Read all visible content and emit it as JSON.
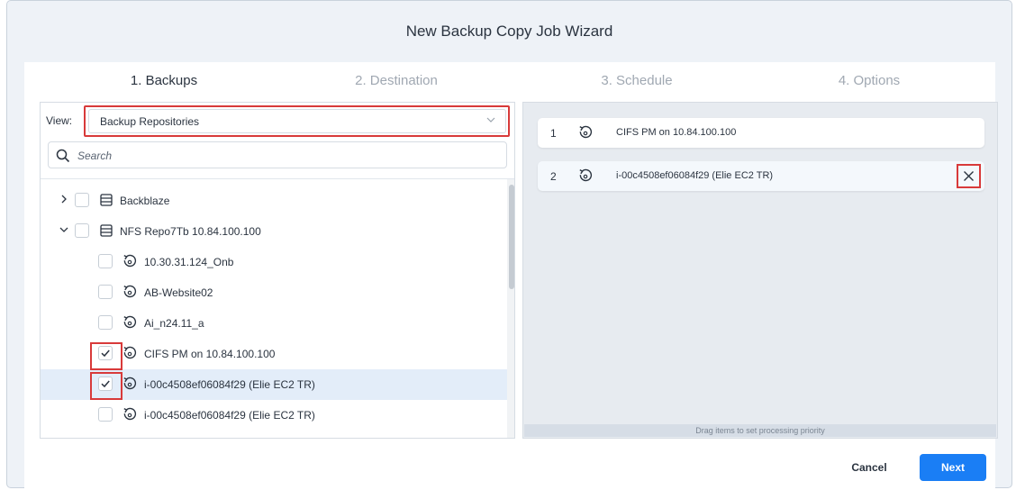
{
  "wizard": {
    "title": "New Backup Copy Job Wizard"
  },
  "steps": [
    {
      "label": "1. Backups",
      "active": true
    },
    {
      "label": "2. Destination",
      "active": false
    },
    {
      "label": "3. Schedule",
      "active": false
    },
    {
      "label": "4. Options",
      "active": false
    }
  ],
  "left": {
    "view_label": "View:",
    "view_value": "Backup Repositories",
    "search_placeholder": "Search",
    "tree": [
      {
        "label": "Backblaze",
        "type": "repository",
        "level": 0,
        "expanded": false,
        "checked": false
      },
      {
        "label": "NFS Repo7Tb 10.84.100.100",
        "type": "repository",
        "level": 0,
        "expanded": true,
        "checked": false
      },
      {
        "label": "10.30.31.124_Onb",
        "type": "backup",
        "level": 1,
        "checked": false
      },
      {
        "label": "AB-Website02",
        "type": "backup",
        "level": 1,
        "checked": false
      },
      {
        "label": "Ai_n24.11_a",
        "type": "backup",
        "level": 1,
        "checked": false
      },
      {
        "label": "CIFS PM on 10.84.100.100",
        "type": "backup",
        "level": 1,
        "checked": true
      },
      {
        "label": "i-00c4508ef06084f29 (Elie EC2 TR)",
        "type": "backup",
        "level": 1,
        "checked": true,
        "selected": true
      },
      {
        "label": "i-00c4508ef06084f29 (Elie EC2 TR)",
        "type": "backup",
        "level": 1,
        "checked": false
      },
      {
        "label": "",
        "type": "backup",
        "level": 1,
        "checked": false
      }
    ]
  },
  "right": {
    "items": [
      {
        "num": "1",
        "label": "CIFS PM on 10.84.100.100"
      },
      {
        "num": "2",
        "label": "i-00c4508ef06084f29 (Elie EC2 TR)"
      }
    ],
    "hint": "Drag items to set processing priority"
  },
  "footer": {
    "cancel": "Cancel",
    "next": "Next"
  },
  "colors": {
    "accent": "#1a7ef5",
    "highlight": "#d83a3a",
    "selected_row": "#e3edf9"
  },
  "icons": {
    "search": "search-icon",
    "repository": "database-icon",
    "backup": "backup-restore-icon",
    "remove": "close-icon"
  }
}
